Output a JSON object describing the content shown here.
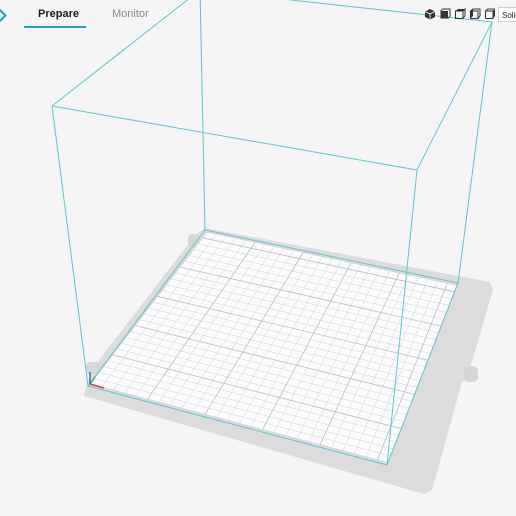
{
  "header": {
    "tabs": [
      {
        "label": "Prepare",
        "active": true
      },
      {
        "label": "Monitor",
        "active": false
      }
    ],
    "accent_color": "#1da1c4"
  },
  "view_toolbar": {
    "buttons": [
      "iso-view-icon",
      "front-view-icon",
      "top-view-icon",
      "left-view-icon",
      "right-view-icon"
    ],
    "view_mode": "Solid"
  },
  "scene": {
    "build_volume_color": "#5cc6d2",
    "plate_color": "#dcdcdc",
    "bed_color": "#fbfbfb",
    "grid_color": "#c9d2da"
  }
}
